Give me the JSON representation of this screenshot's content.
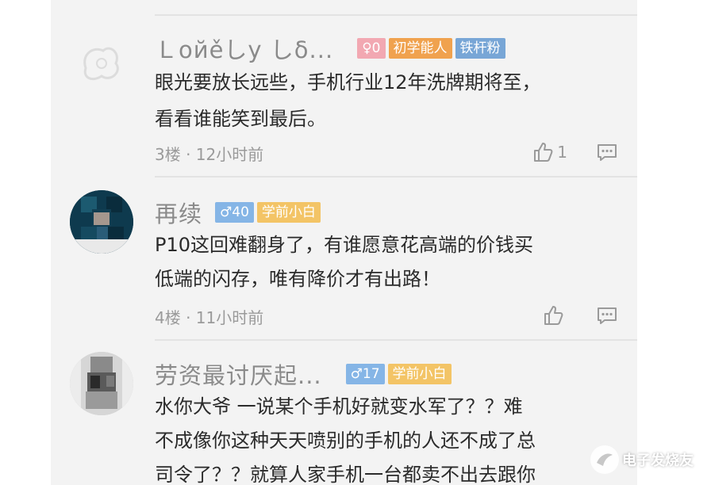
{
  "comments": [
    {
      "username": "Ｌoйěしy しδ...",
      "level": "♀0",
      "title": "初学能人",
      "fan_badge": "铁杆粉",
      "text_lines": [
        "眼光要放长远些，手机行业12年洗牌期将至，",
        "看看谁能笑到最后。"
      ],
      "meta": "3楼 · 12小时前",
      "likes": "1"
    },
    {
      "username": "再续",
      "level": "♂40",
      "title": "学前小白",
      "text_lines": [
        "P10这回难翻身了，有谁愿意花高端的价钱买",
        "低端的闪存，唯有降价才有出路！"
      ],
      "meta": "4楼 · 11小时前",
      "likes": ""
    },
    {
      "username": "劳资最讨厌起...",
      "level": "♂17",
      "title": "学前小白",
      "text_lines": [
        "水你大爷  一说某个手机好就变水军了？？难",
        "不成像你这种天天喷别的手机的人还不成了总",
        "司令了？？就算人家手机一台都卖不出去跟你"
      ]
    }
  ],
  "watermark": {
    "text": "电子发烧友"
  },
  "icons": {
    "like": "thumbs-up-icon",
    "reply": "comment-bubble-icon"
  }
}
